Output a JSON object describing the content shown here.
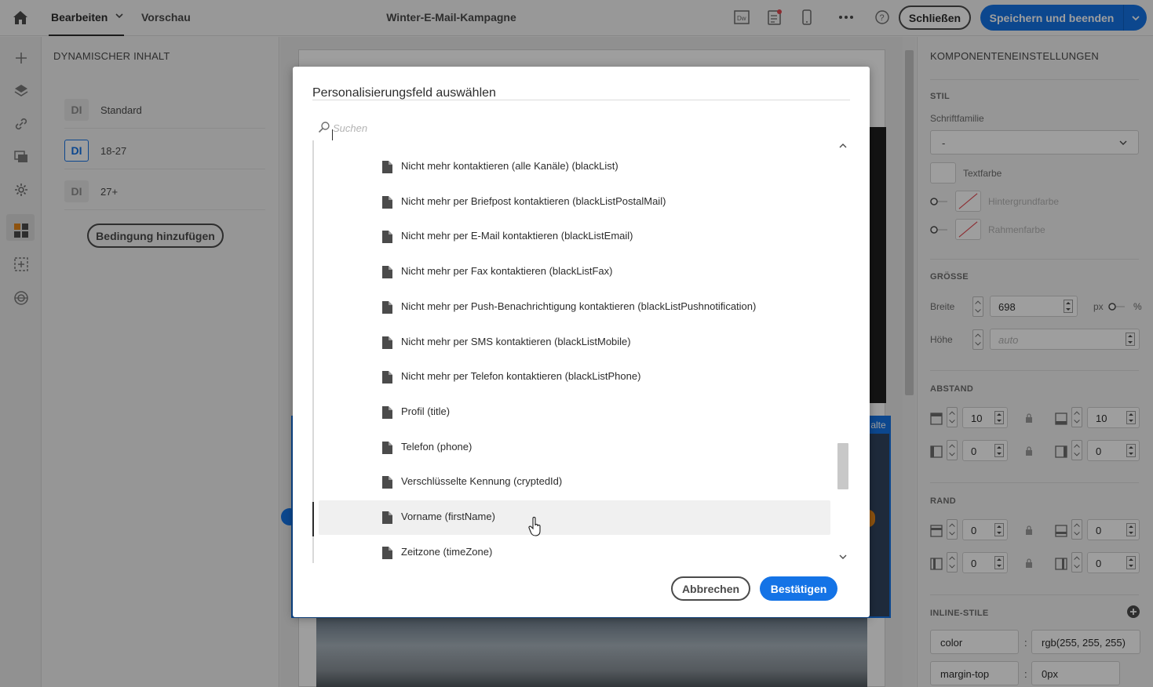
{
  "header": {
    "tab_edit": "Bearbeiten",
    "tab_preview": "Vorschau",
    "title": "Winter-E-Mail-Kampagne",
    "close_label": "Schließen",
    "save_label": "Speichern und beenden",
    "icons": [
      "home-icon",
      "dreamweaver-icon",
      "checklist-icon",
      "mobile-icon",
      "more-icon",
      "help-icon"
    ]
  },
  "left_rail": {
    "icons": [
      "add-icon",
      "layers-icon",
      "link-icon",
      "assets-icon",
      "settings-icon",
      "structure-icon",
      "fragment-icon",
      "target-icon"
    ]
  },
  "dynamic_panel": {
    "title": "DYNAMISCHER INHALT",
    "rows": [
      {
        "badge": "DI",
        "label": "Standard"
      },
      {
        "badge": "DI",
        "label": "18-27"
      },
      {
        "badge": "DI",
        "label": "27+"
      }
    ],
    "add_condition_label": "Bedingung hinzufügen"
  },
  "canvas": {
    "selected_tag": "alte"
  },
  "settings_panel": {
    "title": "KOMPONENTENEINSTELLUNGEN",
    "style_section": "STIL",
    "font_family_label": "Schriftfamilie",
    "font_family_value": "-",
    "text_color_label": "Textfarbe",
    "bg_color_label": "Hintergrundfarbe",
    "border_color_label": "Rahmenfarbe",
    "size_section": "GRÖSSE",
    "width_label": "Breite",
    "width_value": "698",
    "unit_px": "px",
    "unit_pct": "%",
    "height_label": "Höhe",
    "height_placeholder": "auto",
    "spacing_section": "ABSTAND",
    "spacing_values": [
      "10",
      "10",
      "0",
      "0"
    ],
    "border_section": "RAND",
    "border_values": [
      "0",
      "0",
      "0",
      "0"
    ],
    "inline_section": "INLINE-STILE",
    "inline_styles": [
      {
        "property": "color",
        "value": "rgb(255, 255, 255)"
      },
      {
        "property": "margin-top",
        "value": "0px"
      }
    ]
  },
  "modal": {
    "title": "Personalisierungsfeld auswählen",
    "search_placeholder": "Suchen",
    "items": [
      {
        "label": "Nicht mehr kontaktieren (alle Kanäle) (blackList)"
      },
      {
        "label": "Nicht mehr per Briefpost kontaktieren (blackListPostalMail)"
      },
      {
        "label": "Nicht mehr per E-Mail kontaktieren (blackListEmail)"
      },
      {
        "label": "Nicht mehr per Fax kontaktieren (blackListFax)"
      },
      {
        "label": "Nicht mehr per Push-Benachrichtigung kontaktieren (blackListPushnotification)"
      },
      {
        "label": "Nicht mehr per SMS kontaktieren (blackListMobile)"
      },
      {
        "label": "Nicht mehr per Telefon kontaktieren (blackListPhone)"
      },
      {
        "label": "Profil (title)"
      },
      {
        "label": "Telefon (phone)"
      },
      {
        "label": "Verschlüsselte Kennung (cryptedId)"
      },
      {
        "label": "Vorname (firstName)"
      },
      {
        "label": "Zeitzone (timeZone)"
      }
    ],
    "hovered_index": 10,
    "cancel_label": "Abbrechen",
    "confirm_label": "Bestätigen"
  },
  "colors": {
    "accent": "#1473e6",
    "orange": "#e68619"
  }
}
